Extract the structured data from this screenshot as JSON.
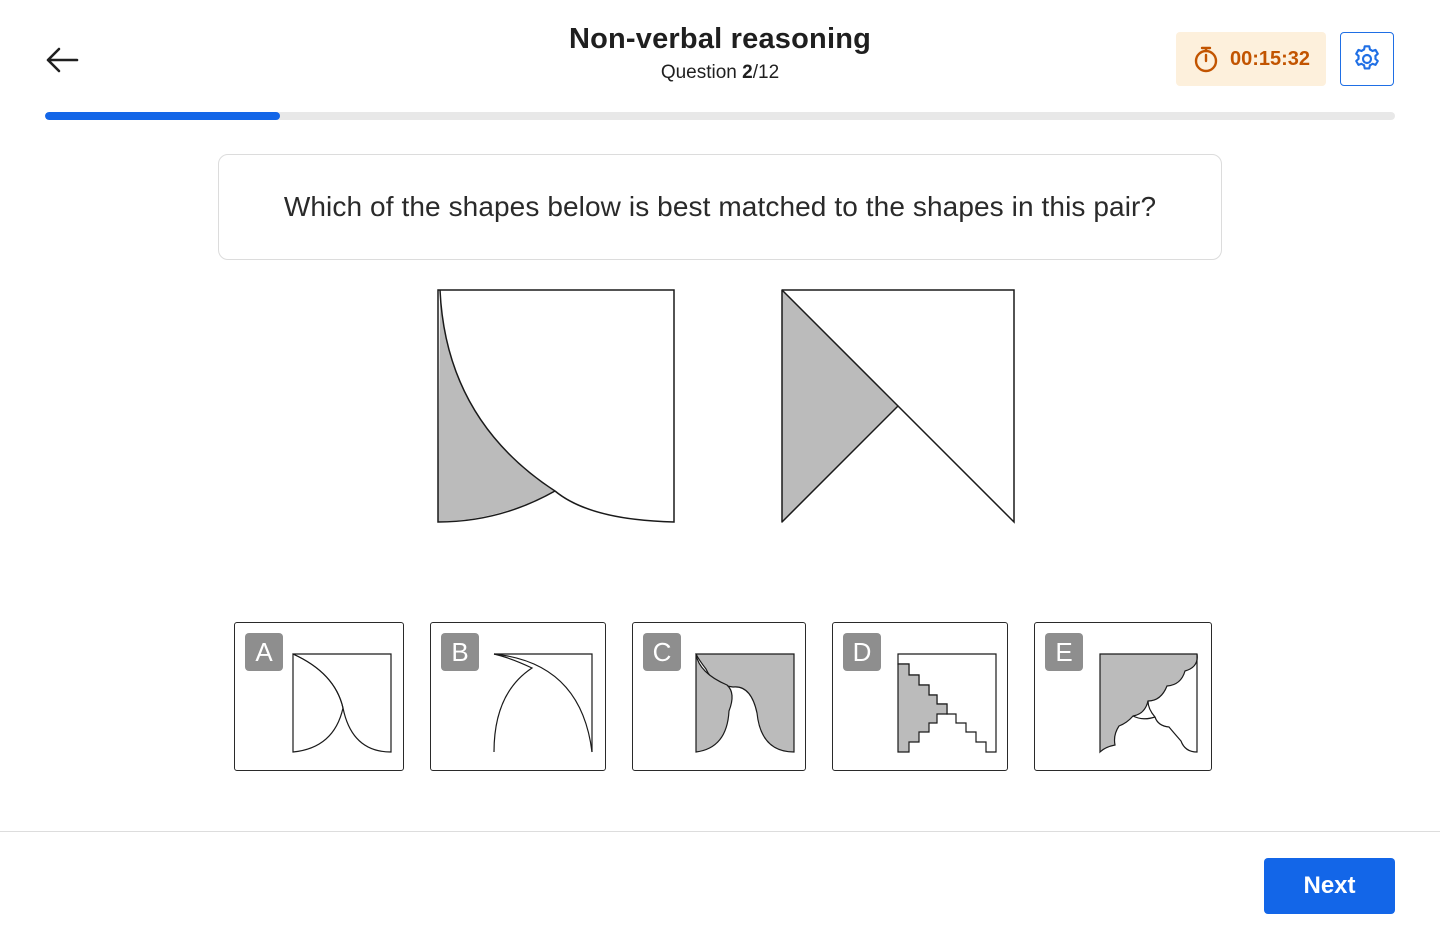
{
  "header": {
    "title": "Non-verbal reasoning",
    "question_prefix": "Question ",
    "question_current": "2",
    "question_total": "/12",
    "timer": "00:15:32",
    "back_icon": "arrow-left-icon",
    "settings_icon": "gear-icon",
    "timer_icon": "stopwatch-icon"
  },
  "progress": {
    "current": 2,
    "total": 12,
    "fraction": 0.174
  },
  "question": {
    "text": "Which of the shapes below is best matched to the shapes in this pair?"
  },
  "options": [
    {
      "letter": "A"
    },
    {
      "letter": "B"
    },
    {
      "letter": "C"
    },
    {
      "letter": "D"
    },
    {
      "letter": "E"
    }
  ],
  "footer": {
    "next_label": "Next"
  },
  "colors": {
    "accent": "#1366e8",
    "timer_bg": "#fdf0dc",
    "timer_text": "#c25400",
    "shape_fill": "#bbbbbb",
    "badge": "#8e8e8e"
  }
}
